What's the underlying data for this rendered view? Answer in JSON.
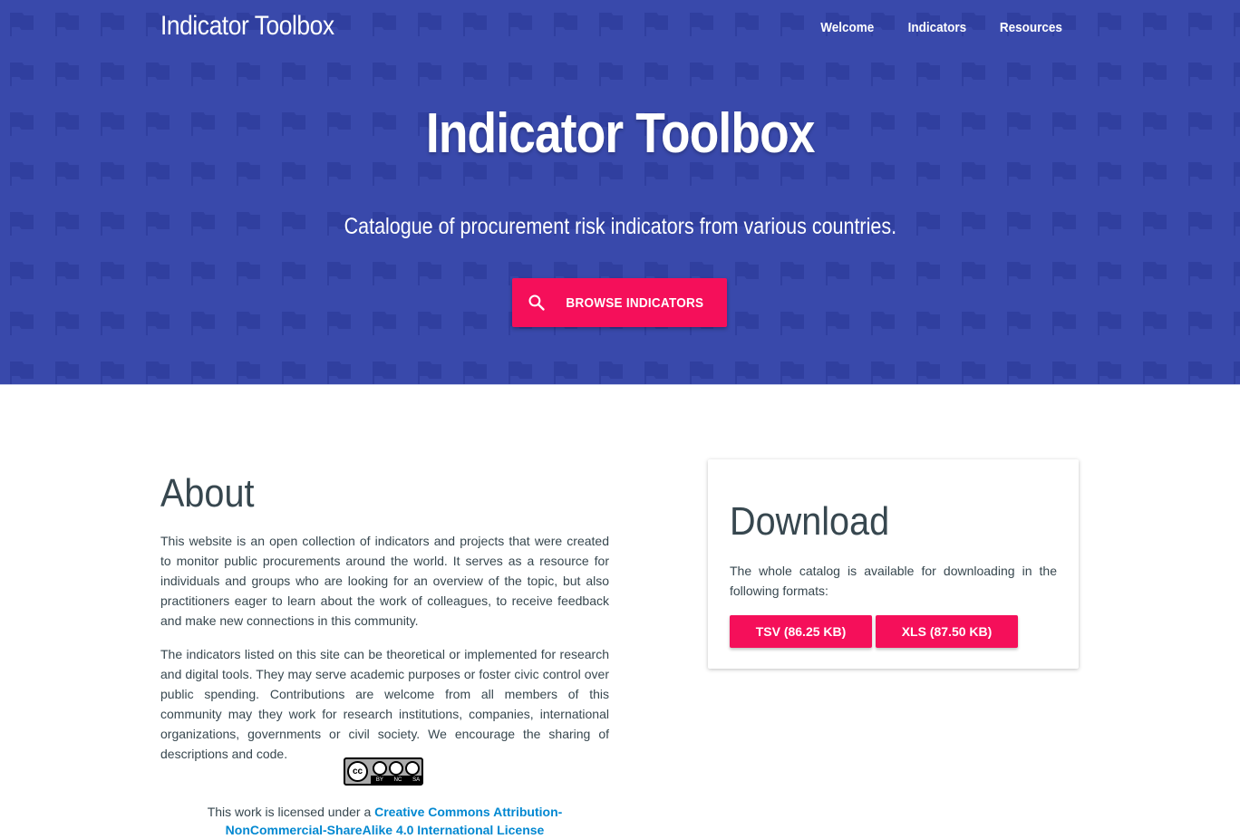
{
  "header": {
    "brand": "Indicator Toolbox",
    "nav": [
      "Welcome",
      "Indicators",
      "Resources"
    ]
  },
  "hero": {
    "title": "Indicator Toolbox",
    "subtitle": "Catalogue of procurement risk indicators from various countries.",
    "browse_label": "BROWSE INDICATORS",
    "browse_icon": "search-icon"
  },
  "about": {
    "heading": "About",
    "paragraphs": [
      "This website is an open collection of indicators and projects that were created to monitor public procurements around the world. It serves as a resource for individuals and groups who are looking for an overview of the topic, but also practitioners eager to learn about the work of colleagues, to receive feedback and make new connections in this community.",
      "The indicators listed on this site can be theoretical or implemented for research and digital tools. They may serve academic purposes or foster civic control over public spending. Contributions are welcome from all members of this community may they work for research institutions, companies, international organizations, governments or civil society. We encourage the sharing of descriptions and code."
    ],
    "license_badge": {
      "cc": "cc",
      "by": "BY",
      "nc": "NC",
      "sa": "SA"
    },
    "license_prefix": "This work is licensed under a ",
    "license_link": "Creative Commons Attribution-NonCommercial-ShareAlike 4.0 International License"
  },
  "download": {
    "heading": "Download",
    "text": "The whole catalog is available for downloading in the following formats:",
    "buttons": [
      "TSV (86.25 KB)",
      "XLS (87.50 KB)"
    ]
  },
  "colors": {
    "hero_bg": "#3949ab",
    "accent": "#f50f5a",
    "link": "#0288d1"
  }
}
